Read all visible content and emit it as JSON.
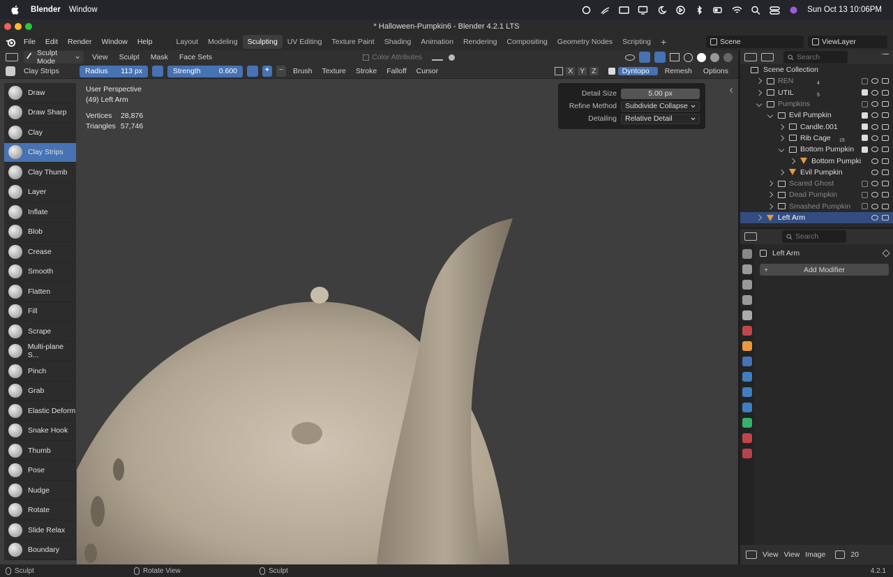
{
  "macos_menubar": {
    "app_name": "Blender",
    "menu": "Window",
    "clock": "Sun Oct 13  10:06PM"
  },
  "window": {
    "title": "* Halloween-Pumpkin6 - Blender 4.2.1 LTS",
    "traffic_colors": [
      "#ff5f57",
      "#febc2e",
      "#28c840"
    ]
  },
  "menubar": {
    "items": [
      "File",
      "Edit",
      "Render",
      "Window",
      "Help"
    ],
    "workspaces": [
      "Layout",
      "Modeling",
      "Sculpting",
      "UV Editing",
      "Texture Paint",
      "Shading",
      "Animation",
      "Rendering",
      "Compositing",
      "Geometry Nodes",
      "Scripting"
    ],
    "active_workspace": "Sculpting",
    "add_workspace": "+",
    "scene": "Scene",
    "view_layer": "ViewLayer"
  },
  "header1": {
    "mode": "Sculpt Mode",
    "menus": [
      "View",
      "Sculpt",
      "Mask",
      "Face Sets"
    ],
    "color_attributes": "Color Attributes"
  },
  "header2": {
    "brush_name": "Clay Strips",
    "radius_label": "Radius",
    "radius_value": "113 px",
    "strength_label": "Strength",
    "strength_value": "0.600",
    "plus": "+",
    "minus": "−",
    "menus": [
      "Brush",
      "Texture",
      "Stroke",
      "Falloff",
      "Cursor"
    ],
    "axes": [
      "X",
      "Y",
      "Z"
    ],
    "dyntopo": "Dyntopo",
    "remesh": "Remesh",
    "options": "Options"
  },
  "viewport_info": {
    "perspective": "User Perspective",
    "object": "(49) Left Arm",
    "vertices_label": "Vertices",
    "vertices_value": "28,876",
    "triangles_label": "Triangles",
    "triangles_value": "57,746"
  },
  "dyntopo_popover": {
    "detail_size_label": "Detail Size",
    "detail_size_value": "5.00 px",
    "refine_method_label": "Refine Method",
    "refine_method_value": "Subdivide Collapse",
    "detailing_label": "Detailing",
    "detailing_value": "Relative Detail"
  },
  "tools": [
    "Draw",
    "Draw Sharp",
    "Clay",
    "Clay Strips",
    "Clay Thumb",
    "Layer",
    "Inflate",
    "Blob",
    "Crease",
    "Smooth",
    "Flatten",
    "Fill",
    "Scrape",
    "Multi-plane S...",
    "Pinch",
    "Grab",
    "Elastic Deform",
    "Snake Hook",
    "Thumb",
    "Pose",
    "Nudge",
    "Rotate",
    "Slide Relax",
    "Boundary"
  ],
  "active_tool": "Clay Strips",
  "outliner": {
    "search_placeholder": "Search",
    "root": "Scene Collection",
    "rows": [
      {
        "name": "REN",
        "indent": 1,
        "dim": true,
        "badge": "4"
      },
      {
        "name": "UTIL",
        "indent": 1,
        "dim": false,
        "badge": "5"
      },
      {
        "name": "Pumpkins",
        "indent": 1,
        "dim": true,
        "badge": ""
      },
      {
        "name": "Evil Pumpkin",
        "indent": 2,
        "dim": false,
        "badge": ""
      },
      {
        "name": "Candle.001",
        "indent": 3,
        "dim": false,
        "badge": ""
      },
      {
        "name": "Rib Cage",
        "indent": 3,
        "dim": false,
        "badge": "15"
      },
      {
        "name": "Bottom Pumpkin",
        "indent": 3,
        "dim": false,
        "badge": ""
      },
      {
        "name": "Bottom Pumpki",
        "indent": 4,
        "dim": false,
        "badge": ""
      },
      {
        "name": "Evil Pumpkin",
        "indent": 3,
        "dim": false,
        "badge": ""
      },
      {
        "name": "Scared Ghost",
        "indent": 2,
        "dim": true,
        "badge": ""
      },
      {
        "name": "Dead Pumpkin",
        "indent": 2,
        "dim": true,
        "badge": ""
      },
      {
        "name": "Smashed Pumpkin",
        "indent": 2,
        "dim": true,
        "badge": ""
      },
      {
        "name": "Left Arm",
        "indent": 1,
        "dim": false,
        "badge": ""
      }
    ],
    "selected": "Left Arm"
  },
  "properties": {
    "search_placeholder": "Search",
    "object_name": "Left Arm",
    "add_modifier": "Add Modifier"
  },
  "image_editor_bar": {
    "view1": "View",
    "view2": "View",
    "image": "Image",
    "num": "20"
  },
  "statusbar": {
    "left": "Sculpt",
    "middle": "Rotate View",
    "right_action": "Sculpt",
    "version": "4.2.1"
  },
  "colors": {
    "accent": "#4772b3",
    "sculpt_clay": "#b9ad9c",
    "viewport_bg": "#3e3e3e",
    "mesh_orange": "#e89a3c"
  }
}
